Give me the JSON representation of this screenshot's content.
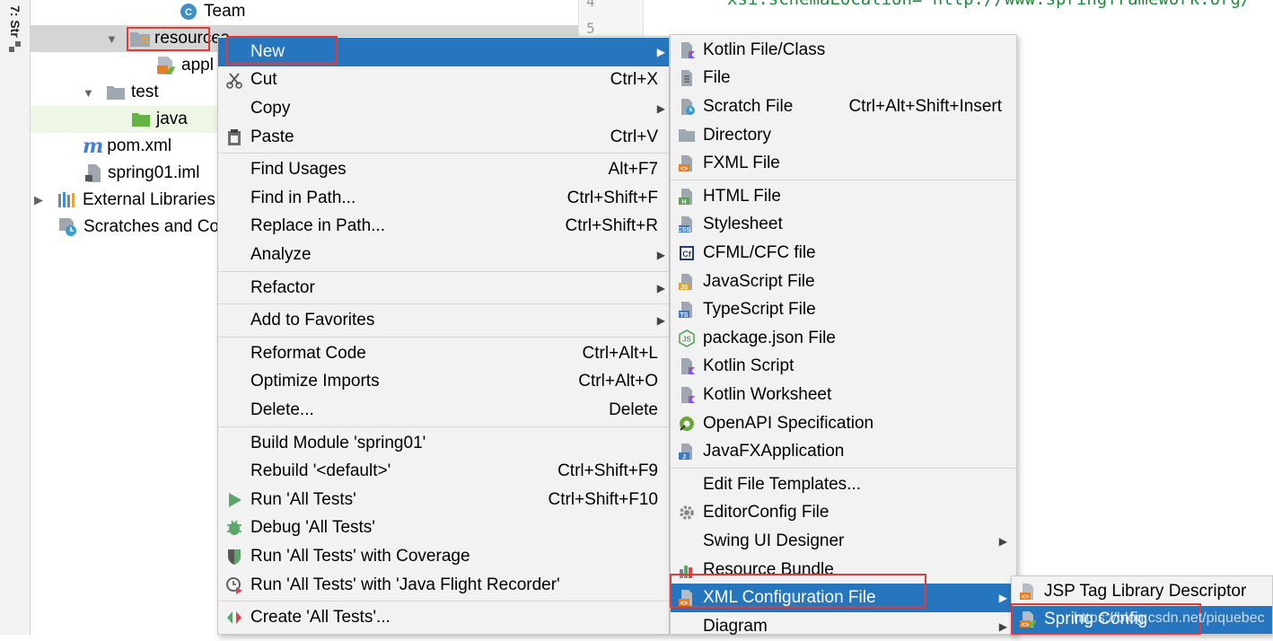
{
  "tool_window": {
    "label": "7: Str"
  },
  "tree": {
    "items": [
      {
        "label": "Team",
        "icon": "class-icon"
      },
      {
        "label": "resources",
        "icon": "resources-folder-icon"
      },
      {
        "label": "appl",
        "icon": "spring-xml-icon"
      },
      {
        "label": "test",
        "icon": "folder-icon"
      },
      {
        "label": "java",
        "icon": "green-folder-icon"
      },
      {
        "label": "pom.xml",
        "icon": "maven-icon"
      },
      {
        "label": "spring01.iml",
        "icon": "iml-file-icon"
      },
      {
        "label": "External Libraries",
        "icon": "libraries-icon"
      },
      {
        "label": "Scratches and Co",
        "icon": "scratches-icon"
      }
    ]
  },
  "gutter": {
    "lines": [
      "4",
      "5"
    ]
  },
  "editor": {
    "line": "xsi:schemaLocation=\"http://www.springframework.org/"
  },
  "context_menu": {
    "items": [
      {
        "label": "New",
        "shortcut": ""
      },
      {
        "label": "Cut",
        "shortcut": "Ctrl+X"
      },
      {
        "label": "Copy",
        "shortcut": ""
      },
      {
        "label": "Paste",
        "shortcut": "Ctrl+V"
      },
      {
        "label": "Find Usages",
        "shortcut": "Alt+F7"
      },
      {
        "label": "Find in Path...",
        "shortcut": "Ctrl+Shift+F"
      },
      {
        "label": "Replace in Path...",
        "shortcut": "Ctrl+Shift+R"
      },
      {
        "label": "Analyze",
        "shortcut": ""
      },
      {
        "label": "Refactor",
        "shortcut": ""
      },
      {
        "label": "Add to Favorites",
        "shortcut": ""
      },
      {
        "label": "Reformat Code",
        "shortcut": "Ctrl+Alt+L"
      },
      {
        "label": "Optimize Imports",
        "shortcut": "Ctrl+Alt+O"
      },
      {
        "label": "Delete...",
        "shortcut": "Delete"
      },
      {
        "label": "Build Module 'spring01'",
        "shortcut": ""
      },
      {
        "label": "Rebuild '<default>'",
        "shortcut": "Ctrl+Shift+F9"
      },
      {
        "label": "Run 'All Tests'",
        "shortcut": "Ctrl+Shift+F10"
      },
      {
        "label": "Debug 'All Tests'",
        "shortcut": ""
      },
      {
        "label": "Run 'All Tests' with Coverage",
        "shortcut": ""
      },
      {
        "label": "Run 'All Tests' with 'Java Flight Recorder'",
        "shortcut": ""
      },
      {
        "label": "Create 'All Tests'...",
        "shortcut": ""
      }
    ]
  },
  "new_menu": {
    "items": [
      {
        "label": "Kotlin File/Class",
        "shortcut": ""
      },
      {
        "label": "File",
        "shortcut": ""
      },
      {
        "label": "Scratch File",
        "shortcut": "Ctrl+Alt+Shift+Insert"
      },
      {
        "label": "Directory",
        "shortcut": ""
      },
      {
        "label": "FXML File",
        "shortcut": ""
      },
      {
        "label": "HTML File",
        "shortcut": ""
      },
      {
        "label": "Stylesheet",
        "shortcut": ""
      },
      {
        "label": "CFML/CFC file",
        "shortcut": ""
      },
      {
        "label": "JavaScript File",
        "shortcut": ""
      },
      {
        "label": "TypeScript File",
        "shortcut": ""
      },
      {
        "label": "package.json File",
        "shortcut": ""
      },
      {
        "label": "Kotlin Script",
        "shortcut": ""
      },
      {
        "label": "Kotlin Worksheet",
        "shortcut": ""
      },
      {
        "label": "OpenAPI Specification",
        "shortcut": ""
      },
      {
        "label": "JavaFXApplication",
        "shortcut": ""
      },
      {
        "label": "Edit File Templates...",
        "shortcut": ""
      },
      {
        "label": "EditorConfig File",
        "shortcut": ""
      },
      {
        "label": "Swing UI Designer",
        "shortcut": ""
      },
      {
        "label": "Resource Bundle",
        "shortcut": ""
      },
      {
        "label": "XML Configuration File",
        "shortcut": ""
      },
      {
        "label": "Diagram",
        "shortcut": ""
      }
    ]
  },
  "xml_menu": {
    "items": [
      {
        "label": "JSP Tag Library Descriptor"
      },
      {
        "label": "Spring Config"
      }
    ]
  },
  "watermark": "https://blog.csdn.net/piquebec",
  "colors": {
    "selection": "#2675bf",
    "highlight_box": "#e53935",
    "menu_bg": "#f2f2f2"
  }
}
